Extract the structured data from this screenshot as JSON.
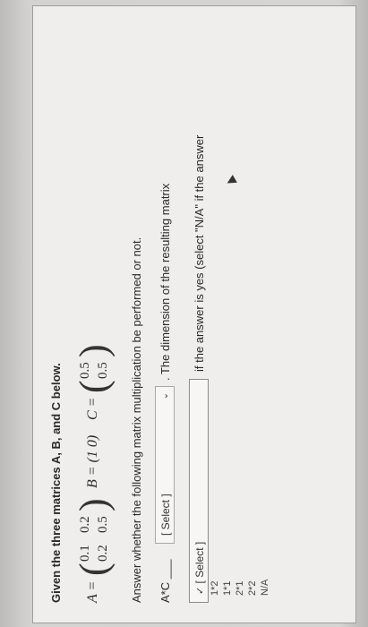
{
  "question": {
    "intro": "Given the three matrices A, B, and C below.",
    "matrix_a": {
      "label": "A =",
      "r1c1": "0.1",
      "r1c2": "0.2",
      "r2c1": "0.2",
      "r2c2": "0.5"
    },
    "matrix_b": {
      "label": "B = (1   0)"
    },
    "matrix_c": {
      "label": "C =",
      "r1": "0.5",
      "r2": "0.5"
    },
    "prompt": "Answer whether the following matrix multiplication be performed or not.",
    "row_label": "A*C ___",
    "select_placeholder": "[ Select ]",
    "dimension_text": ". The dimension of the resulting matrix",
    "if_text": "if the answer is yes (select \"N/A\" if the answer"
  },
  "dropdown_open": {
    "selected": "[ Select ]",
    "options": [
      "1*2",
      "1*1",
      "2*1",
      "2*2",
      "N/A"
    ]
  }
}
